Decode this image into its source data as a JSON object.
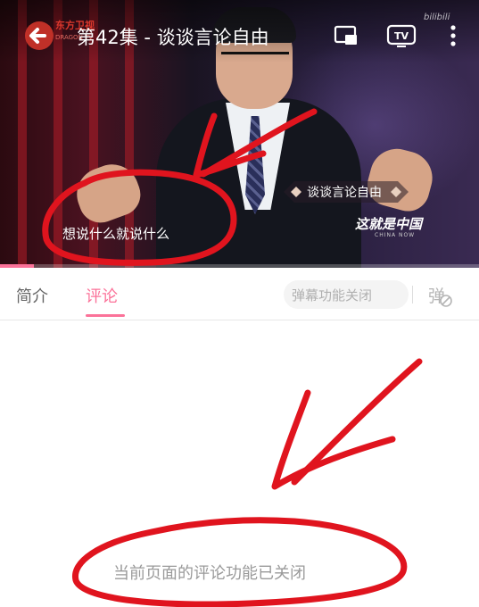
{
  "player": {
    "title": "第42集 - 谈谈言论自由",
    "logo_text": "东方卫视",
    "logo_sub": "DRAGON TV",
    "watermark": "bilibili",
    "program_label": "谈谈言论自由",
    "show_logo": "这就是中国",
    "show_logo_sub": "CHINA NOW",
    "subtitle": "想说什么就说什么",
    "progress": 0.07
  },
  "tabs": {
    "intro": "简介",
    "comments": "评论",
    "active": "comments"
  },
  "danmaku": {
    "status_label": "弹幕功能关闭",
    "icon": "danmaku-off-icon"
  },
  "comments": {
    "closed_notice": "当前页面的评论功能已关闭"
  },
  "colors": {
    "accent": "#fb7299",
    "annotation": "#e0141e"
  }
}
